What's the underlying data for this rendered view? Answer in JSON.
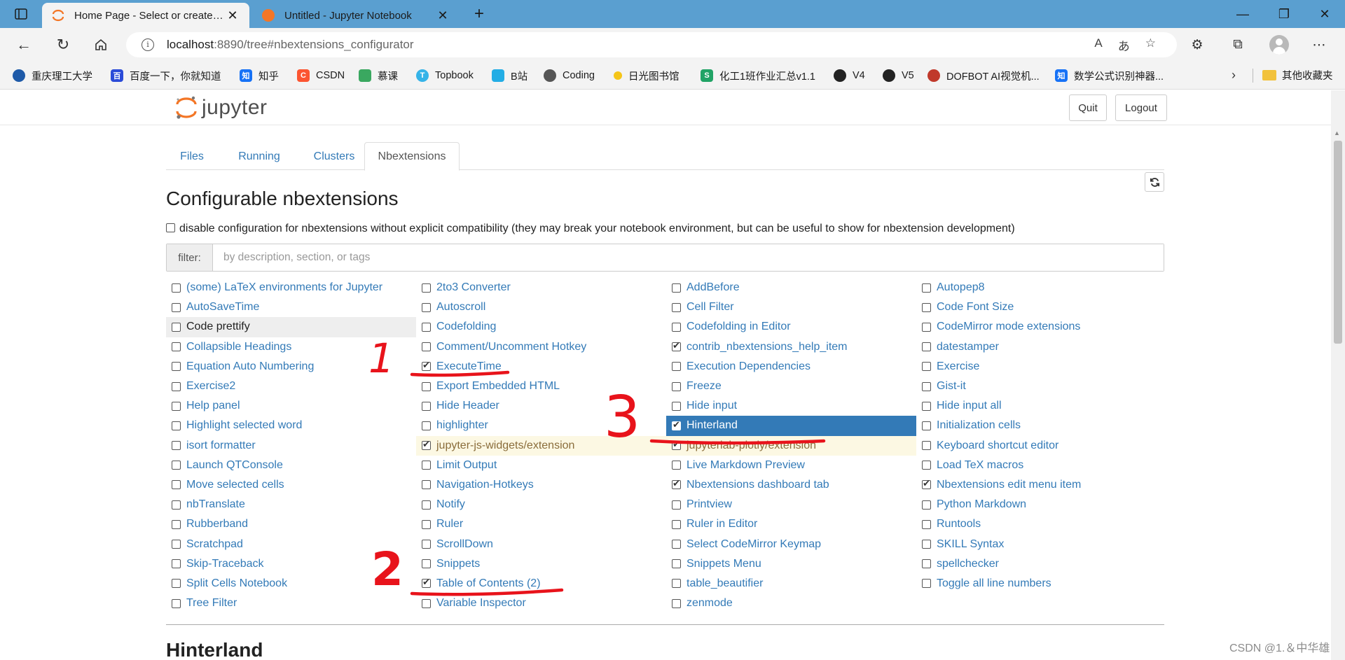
{
  "browser": {
    "tabs": [
      {
        "title": "Home Page - Select or create a notebook",
        "active": true
      },
      {
        "title": "Untitled - Jupyter Notebook",
        "active": false
      }
    ],
    "url_host": "localhost",
    "url_path": ":8890/tree#nbextensions_configurator",
    "bookmarks": [
      {
        "label": "重庆理工大学",
        "color": "#1e5aa8"
      },
      {
        "label": "百度一下，你就知道",
        "color": "#2b4bd8"
      },
      {
        "label": "知乎",
        "color": "#1772f6"
      },
      {
        "label": "CSDN",
        "color": "#fc5531"
      },
      {
        "label": "慕课",
        "color": "#3aa860"
      },
      {
        "label": "Topbook",
        "color": "#35b3e8"
      },
      {
        "label": "B站",
        "color": "#23ade5"
      },
      {
        "label": "Coding",
        "color": "#555555"
      },
      {
        "label": "日光图书馆",
        "color": "#f5c518"
      },
      {
        "label": "化工1班作业汇总v1.1",
        "color": "#21a366"
      },
      {
        "label": "V4",
        "color": "#222222"
      },
      {
        "label": "V5",
        "color": "#222222"
      },
      {
        "label": "DOFBOT AI视觉机...",
        "color": "#c0392b"
      },
      {
        "label": "数学公式识别神器...",
        "color": "#1772f6"
      }
    ],
    "bookmarks_folder": "其他收藏夹"
  },
  "header": {
    "logo_text": "jupyter",
    "quit_label": "Quit",
    "logout_label": "Logout"
  },
  "tabs": [
    "Files",
    "Running",
    "Clusters",
    "Nbextensions"
  ],
  "page": {
    "title": "Configurable nbextensions",
    "compat_text": "disable configuration for nbextensions without explicit compatibility (they may break your notebook environment, but can be useful to show for nbextension development)",
    "filter_label": "filter:",
    "filter_placeholder": "by description, section, or tags",
    "section_title": "Hinterland"
  },
  "extensions": {
    "col1": [
      {
        "name": "(some) LaTeX environments for Jupyter",
        "checked": false
      },
      {
        "name": "AutoSaveTime",
        "checked": false
      },
      {
        "name": "Code prettify",
        "checked": false,
        "state": "hover"
      },
      {
        "name": "Collapsible Headings",
        "checked": false
      },
      {
        "name": "Equation Auto Numbering",
        "checked": false
      },
      {
        "name": "Exercise2",
        "checked": false
      },
      {
        "name": "Help panel",
        "checked": false
      },
      {
        "name": "Highlight selected word",
        "checked": false
      },
      {
        "name": "isort formatter",
        "checked": false
      },
      {
        "name": "Launch QTConsole",
        "checked": false
      },
      {
        "name": "Move selected cells",
        "checked": false
      },
      {
        "name": "nbTranslate",
        "checked": false
      },
      {
        "name": "Rubberband",
        "checked": false
      },
      {
        "name": "Scratchpad",
        "checked": false
      },
      {
        "name": "Skip-Traceback",
        "checked": false
      },
      {
        "name": "Split Cells Notebook",
        "checked": false
      },
      {
        "name": "Tree Filter",
        "checked": false
      }
    ],
    "col2": [
      {
        "name": "2to3 Converter",
        "checked": false
      },
      {
        "name": "Autoscroll",
        "checked": false
      },
      {
        "name": "Codefolding",
        "checked": false
      },
      {
        "name": "Comment/Uncomment Hotkey",
        "checked": false
      },
      {
        "name": "ExecuteTime",
        "checked": true
      },
      {
        "name": "Export Embedded HTML",
        "checked": false
      },
      {
        "name": "Hide Header",
        "checked": false
      },
      {
        "name": "highlighter",
        "checked": false
      },
      {
        "name": "jupyter-js-widgets/extension",
        "checked": true,
        "state": "warn"
      },
      {
        "name": "Limit Output",
        "checked": false
      },
      {
        "name": "Navigation-Hotkeys",
        "checked": false
      },
      {
        "name": "Notify",
        "checked": false
      },
      {
        "name": "Ruler",
        "checked": false
      },
      {
        "name": "ScrollDown",
        "checked": false
      },
      {
        "name": "Snippets",
        "checked": false
      },
      {
        "name": "Table of Contents (2)",
        "checked": true
      },
      {
        "name": "Variable Inspector",
        "checked": false
      }
    ],
    "col3": [
      {
        "name": "AddBefore",
        "checked": false
      },
      {
        "name": "Cell Filter",
        "checked": false
      },
      {
        "name": "Codefolding in Editor",
        "checked": false
      },
      {
        "name": "contrib_nbextensions_help_item",
        "checked": true
      },
      {
        "name": "Execution Dependencies",
        "checked": false
      },
      {
        "name": "Freeze",
        "checked": false
      },
      {
        "name": "Hide input",
        "checked": false
      },
      {
        "name": "Hinterland",
        "checked": true,
        "state": "selected"
      },
      {
        "name": "jupyterlab-plotly/extension",
        "checked": true,
        "state": "warn"
      },
      {
        "name": "Live Markdown Preview",
        "checked": false
      },
      {
        "name": "Nbextensions dashboard tab",
        "checked": true
      },
      {
        "name": "Printview",
        "checked": false
      },
      {
        "name": "Ruler in Editor",
        "checked": false
      },
      {
        "name": "Select CodeMirror Keymap",
        "checked": false
      },
      {
        "name": "Snippets Menu",
        "checked": false
      },
      {
        "name": "table_beautifier",
        "checked": false
      },
      {
        "name": "zenmode",
        "checked": false
      }
    ],
    "col4": [
      {
        "name": "Autopep8",
        "checked": false
      },
      {
        "name": "Code Font Size",
        "checked": false
      },
      {
        "name": "CodeMirror mode extensions",
        "checked": false
      },
      {
        "name": "datestamper",
        "checked": false
      },
      {
        "name": "Exercise",
        "checked": false
      },
      {
        "name": "Gist-it",
        "checked": false
      },
      {
        "name": "Hide input all",
        "checked": false
      },
      {
        "name": "Initialization cells",
        "checked": false
      },
      {
        "name": "Keyboard shortcut editor",
        "checked": false
      },
      {
        "name": "Load TeX macros",
        "checked": false
      },
      {
        "name": "Nbextensions edit menu item",
        "checked": true
      },
      {
        "name": "Python Markdown",
        "checked": false
      },
      {
        "name": "Runtools",
        "checked": false
      },
      {
        "name": "SKILL Syntax",
        "checked": false
      },
      {
        "name": "spellchecker",
        "checked": false
      },
      {
        "name": "Toggle all line numbers",
        "checked": false
      }
    ]
  },
  "annotations": [
    "1",
    "2",
    "3"
  ],
  "watermark": "CSDN @1.＆中华雄",
  "colors": {
    "accent": "#337ab7",
    "annotation": "#e8131b",
    "titlebar": "#5a9fd0"
  }
}
